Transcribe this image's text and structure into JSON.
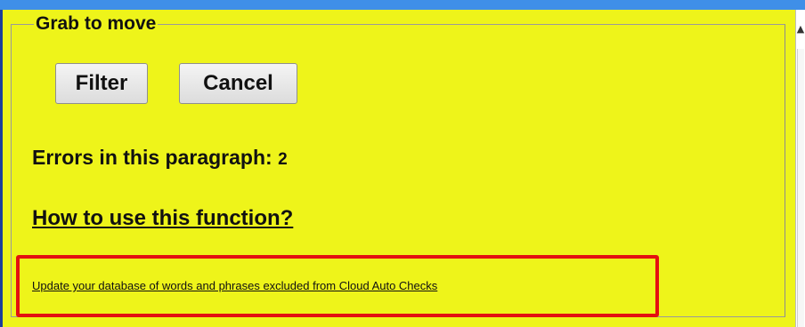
{
  "dialog": {
    "legend": "Grab to move",
    "buttons": {
      "filter_label": "Filter",
      "cancel_label": "Cancel"
    },
    "errors": {
      "label": "Errors in this paragraph: ",
      "count": "2"
    },
    "help_link": "How to use this function?",
    "update_link": "Update your database of words and phrases excluded from Cloud Auto Checks"
  },
  "colors": {
    "panel_background": "#eef41a",
    "title_bar": "#3f8fe8",
    "highlight_border": "#e41010"
  },
  "icons": {
    "scroll_up": "scroll-up-arrow-icon"
  }
}
